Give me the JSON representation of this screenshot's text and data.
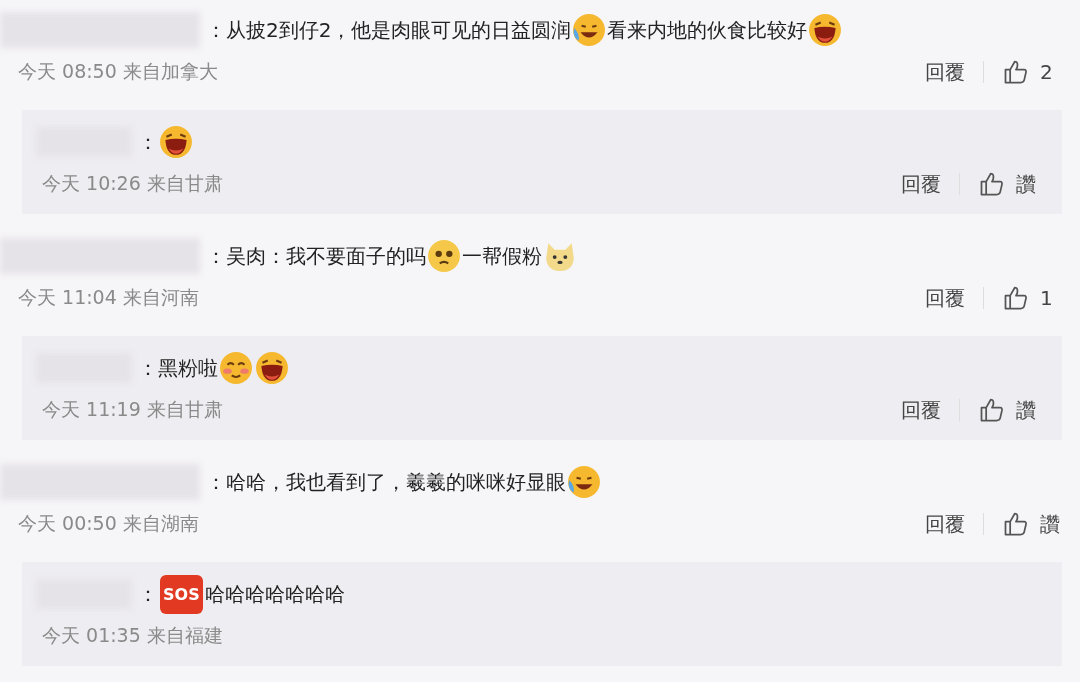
{
  "comments": [
    {
      "segments": [
        {
          "kind": "text",
          "text": "：从披2到仔2，他是肉眼可见的日益圆润"
        },
        {
          "kind": "tear-laugh"
        },
        {
          "kind": "text",
          "text": "看来内地的伙食比较好"
        },
        {
          "kind": "grin"
        }
      ],
      "meta": "今天 08:50 来自加拿大",
      "reply": "回覆",
      "like": "2",
      "replies": [
        {
          "segments": [
            {
              "kind": "text",
              "text": "："
            },
            {
              "kind": "grin"
            }
          ],
          "meta": "今天 10:26 来自甘肃",
          "reply": "回覆",
          "like": "讚"
        }
      ]
    },
    {
      "segments": [
        {
          "kind": "text",
          "text": "：吴肉：我不要面子的吗"
        },
        {
          "kind": "sad"
        },
        {
          "kind": "text",
          "text": "一帮假粉"
        },
        {
          "kind": "dog"
        }
      ],
      "meta": "今天 11:04 来自河南",
      "reply": "回覆",
      "like": "1",
      "replies": [
        {
          "segments": [
            {
              "kind": "text",
              "text": "：黑粉啦"
            },
            {
              "kind": "blush"
            },
            {
              "kind": "grin"
            }
          ],
          "meta": "今天 11:19 来自甘肃",
          "reply": "回覆",
          "like": "讚"
        }
      ]
    },
    {
      "segments": [
        {
          "kind": "text",
          "text": "：哈哈，我也看到了，羲羲的咪咪好显眼"
        },
        {
          "kind": "tear-laugh"
        }
      ],
      "meta": "今天 00:50 来自湖南",
      "reply": "回覆",
      "like": "讚",
      "replies": [
        {
          "segments": [
            {
              "kind": "text",
              "text": "："
            },
            {
              "kind": "badge",
              "text": "SOS"
            },
            {
              "kind": "text",
              "text": "哈哈哈哈哈哈哈"
            }
          ],
          "meta": "今天 01:35 来自福建"
        }
      ]
    }
  ]
}
